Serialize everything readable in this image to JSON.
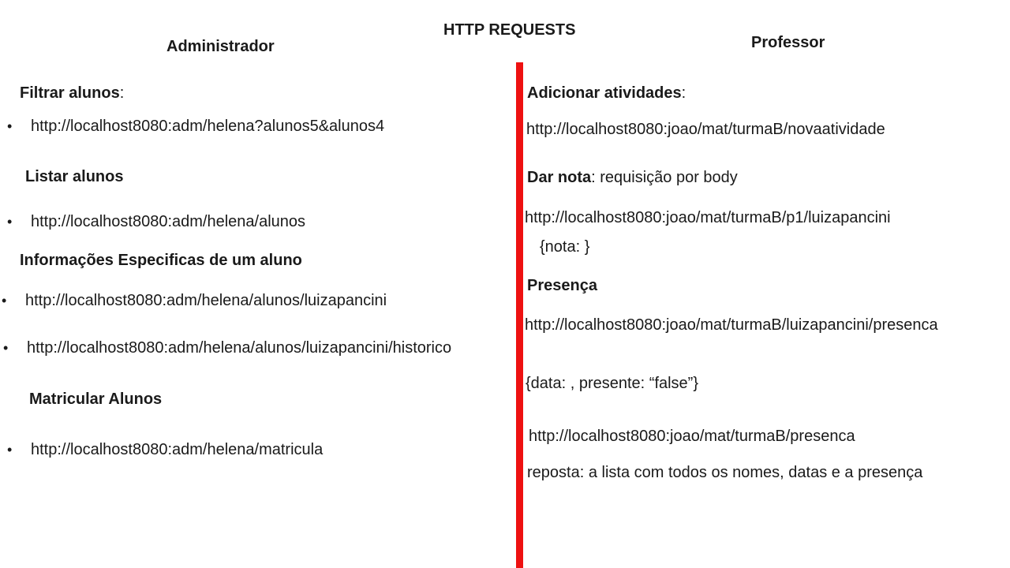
{
  "slide": {
    "title": "HTTP REQUESTS",
    "colors": {
      "divider": "#ee1111",
      "text": "#1a1a1a",
      "background": "#ffffff"
    }
  },
  "admin": {
    "header": "Administrador",
    "filtrar": {
      "heading": "Filtrar alunos",
      "colon": ":",
      "url": "http://localhost8080:adm/helena?alunos5&alunos4"
    },
    "listar": {
      "heading": "Listar alunos",
      "url": "http://localhost8080:adm/helena/alunos"
    },
    "info": {
      "heading": "Informações Especificas de um aluno",
      "url1": "http://localhost8080:adm/helena/alunos/luizapancini",
      "url2": "http://localhost8080:adm/helena/alunos/luizapancini/historico"
    },
    "matricular": {
      "heading": "Matricular Alunos",
      "url": "http://localhost8080:adm/helena/matricula"
    },
    "bullet_glyph": "•"
  },
  "professor": {
    "header": "Professor",
    "adicionar": {
      "heading": "Adicionar atividades",
      "colon": ":",
      "url": "http://localhost8080:joao/mat/turmaB/novaatividade"
    },
    "nota": {
      "heading": "Dar nota",
      "rest": ": requisição por body",
      "url": "http://localhost8080:joao/mat/turmaB/p1/luizapancini",
      "body": "{nota: }"
    },
    "presenca": {
      "heading": "Presença",
      "url": "http://localhost8080:joao/mat/turmaB/luizapancini/presenca",
      "body": "{data: , presente: “false”}",
      "url2": "http://localhost8080:joao/mat/turmaB/presenca",
      "resposta": "reposta: a lista com todos os nomes, datas e a presença"
    }
  }
}
